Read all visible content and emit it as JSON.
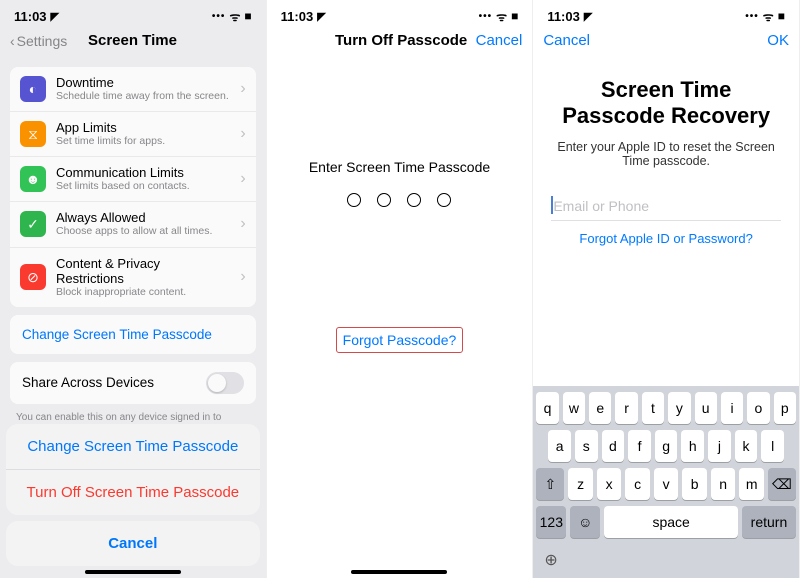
{
  "status": {
    "time": "11:03",
    "loc": "◤",
    "dots": "•••",
    "wifi": "ᯤ",
    "batt": "■"
  },
  "p1": {
    "back": "Settings",
    "title": "Screen Time",
    "rows": [
      {
        "icon": "◐",
        "cls": "ic-purple",
        "name": "downtime",
        "t": "Downtime",
        "s": "Schedule time away from the screen."
      },
      {
        "icon": "⧖",
        "cls": "ic-orange",
        "name": "app-limits",
        "t": "App Limits",
        "s": "Set time limits for apps."
      },
      {
        "icon": "☻",
        "cls": "ic-green",
        "name": "comm-limits",
        "t": "Communication Limits",
        "s": "Set limits based on contacts."
      },
      {
        "icon": "✓",
        "cls": "ic-green2",
        "name": "always-allowed",
        "t": "Always Allowed",
        "s": "Choose apps to allow at all times."
      },
      {
        "icon": "⊘",
        "cls": "ic-red",
        "name": "content-priv",
        "t": "Content & Privacy Restrictions",
        "s": "Block inappropriate content."
      }
    ],
    "change": "Change Screen Time Passcode",
    "share": "Share Across Devices",
    "hint": "You can enable this on any device signed in to",
    "sheet": {
      "change": "Change Screen Time Passcode",
      "turnoff": "Turn Off Screen Time Passcode",
      "cancel": "Cancel"
    }
  },
  "p2": {
    "title": "Turn Off Passcode",
    "cancel": "Cancel",
    "enter": "Enter Screen Time Passcode",
    "forgot": "Forgot Passcode?"
  },
  "p3": {
    "cancel": "Cancel",
    "ok": "OK",
    "h1a": "Screen Time",
    "h1b": "Passcode Recovery",
    "sub": "Enter your Apple ID to reset the Screen Time passcode.",
    "placeholder": "Email or Phone",
    "forgot": "Forgot Apple ID or Password?",
    "kb": {
      "r1": [
        "q",
        "w",
        "e",
        "r",
        "t",
        "y",
        "u",
        "i",
        "o",
        "p"
      ],
      "r2": [
        "a",
        "s",
        "d",
        "f",
        "g",
        "h",
        "j",
        "k",
        "l"
      ],
      "r3": [
        "z",
        "x",
        "c",
        "v",
        "b",
        "n",
        "m"
      ],
      "shift": "⇧",
      "bksp": "⌫",
      "num": "123",
      "emoji": "☺",
      "space": "space",
      "ret": "return",
      "globe": "⊕"
    }
  }
}
